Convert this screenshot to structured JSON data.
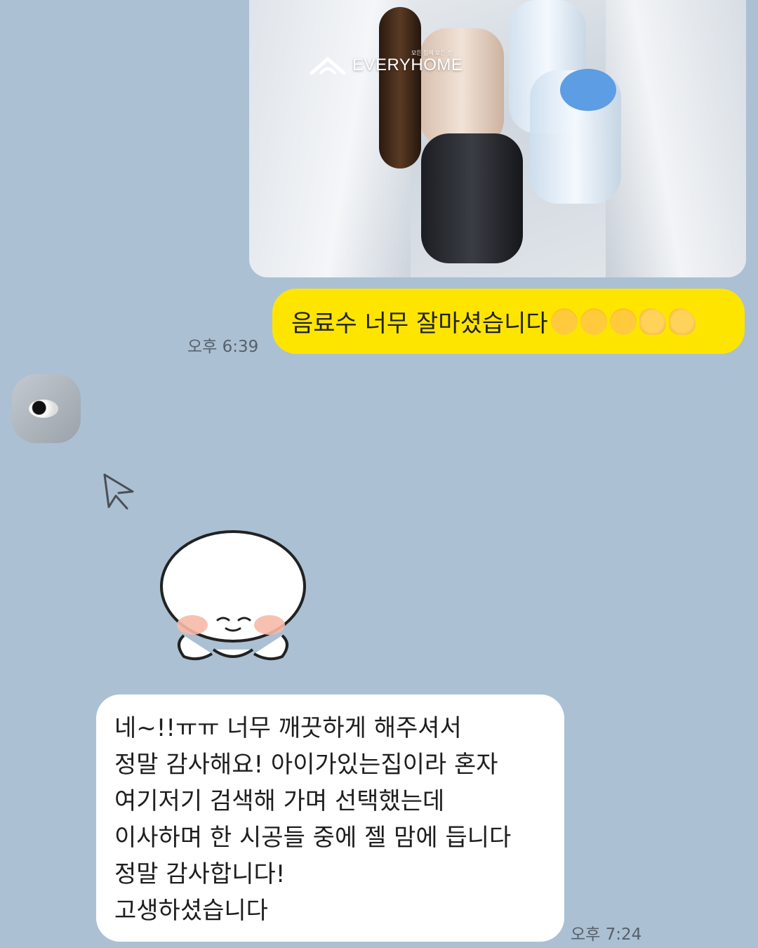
{
  "photo": {
    "logo_text": "EVERYHOME",
    "logo_tag": "모든 집에 모든 것"
  },
  "messages": [
    {
      "side": "right",
      "text": "음료수 너무 잘마셨습니다",
      "emojis": [
        "loudly-crying-face",
        "loudly-crying-face",
        "loudly-crying-face",
        "thumbs-up",
        "thumbs-up"
      ],
      "time": "오후 6:39"
    },
    {
      "side": "left",
      "lines": [
        "네~!!ㅠㅠ 너무 깨끗하게 해주셔서",
        "정말 감사해요! 아이가있는집이라 혼자",
        "여기저기 검색해 가며 선택했는데",
        "이사하며 한 시공들 중에 젤 맘에 듭니다",
        "정말 감사합니다!",
        "고생하셨습니다"
      ],
      "time": "오후 7:24"
    }
  ],
  "colors": {
    "background": "#abc0d3",
    "my_bubble": "#fee500",
    "their_bubble": "#ffffff"
  }
}
